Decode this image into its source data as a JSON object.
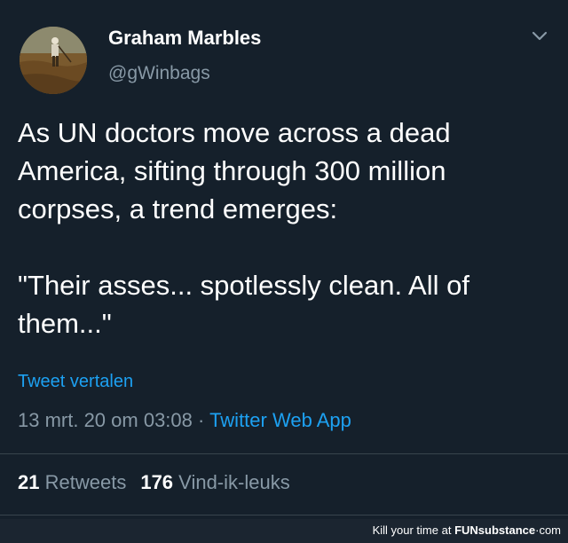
{
  "author": {
    "display_name": "Graham Marbles",
    "handle": "@gWinbags"
  },
  "tweet": {
    "paragraphs": [
      "As UN doctors move across a dead America, sifting through 300 million corpses, a trend emerges:",
      "\"Their asses... spotlessly clean. All of them...\""
    ],
    "translate_label": "Tweet vertalen",
    "timestamp": "13 mrt. 20 om 03:08",
    "separator": "·",
    "source": "Twitter Web App"
  },
  "stats": {
    "retweets_count": "21",
    "retweets_label": "Retweets",
    "likes_count": "176",
    "likes_label": "Vind-ik-leuks"
  },
  "watermark": {
    "prefix": "Kill your time at",
    "brand_fun": "FUN",
    "brand_sub": "substance",
    "suffix": "·com"
  },
  "icons": {
    "menu": "chevron-down-icon"
  },
  "colors": {
    "background": "#15202b",
    "link": "#1da1f2",
    "muted": "#8899a6",
    "divider": "#38444d"
  }
}
